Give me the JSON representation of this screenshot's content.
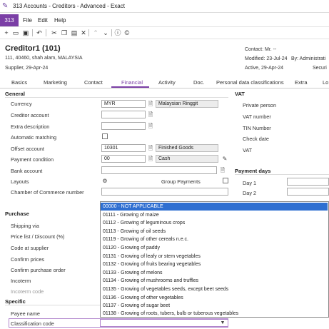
{
  "window": {
    "title": "313 Accounts - Creditors - Advanced - Exact"
  },
  "app": {
    "badge": "313"
  },
  "menu": {
    "file": "File",
    "edit": "Edit",
    "help": "Help"
  },
  "header": {
    "title": "Creditor1 (101)",
    "address": "111, 40460, shah alam, MALAYSIA",
    "supplier": "Supplier, 29-Apr-24",
    "contact": "Contact: Mr. --",
    "modified": "Modified: 23-Jul-24",
    "modified_by": "By: Administrati",
    "active": "Active, 29-Apr-24",
    "securi": "Securi"
  },
  "tabs": [
    "Basics",
    "Marketing",
    "Contact",
    "Financial",
    "Activity",
    "Doc.",
    "Personal data classifications",
    "Extra",
    "Lo"
  ],
  "active_tab": "Financial",
  "general": {
    "section": "General",
    "currency_label": "Currency",
    "currency_value": "MYR",
    "currency_name": "Malaysian Ringgit",
    "creditor_account_label": "Creditor account",
    "extra_description_label": "Extra description",
    "automatic_matching_label": "Automatic matching",
    "offset_account_label": "Offset account",
    "offset_account_value": "10301",
    "offset_account_name": "Finished Goods",
    "payment_condition_label": "Payment condition",
    "payment_condition_value": "00",
    "payment_condition_name": "Cash",
    "bank_account_label": "Bank account",
    "layouts_label": "Layouts",
    "group_payments_label": "Group Payments",
    "coc_label": "Chamber of Commerce number"
  },
  "vat": {
    "section": "VAT",
    "private_person": "Private person",
    "vat_number": "VAT number",
    "tin_number": "TIN Number",
    "check_date": "Check date",
    "vat": "VAT"
  },
  "payment_days": {
    "section": "Payment days",
    "day1": "Day 1",
    "day2": "Day 2"
  },
  "purchase": {
    "section": "Purchase",
    "shipping_via": "Shipping via",
    "price_list": "Price list / Discount (%)",
    "code_at_supplier": "Code at supplier",
    "confirm_prices": "Confirm prices",
    "confirm_purchase_order": "Confirm purchase order",
    "incoterm": "Incoterm",
    "incoterm_code": "Incoterm code"
  },
  "specific": {
    "section": "Specific",
    "payee_name": "Payee name",
    "classification_code": "Classification code"
  },
  "classification_options": [
    "00000 - NOT APPLICABLE",
    "01111 - Growing of maize",
    "01112 - Growing of leguminous crops",
    "01113 - Growing of oil seeds",
    "01119 - Growing of other cereals n.e.c.",
    "01120 - Growing of paddy",
    "01131 - Growing of leafy or stem vegetables",
    "01132 - Growing of fruits bearing vegetables",
    "01133 - Growing of melons",
    "01134 - Growing of mushrooms and truffles",
    "01135 - Growing of vegetables seeds, except beet seeds",
    "01136 - Growing of other vegetables",
    "01137 - Growing of sugar beet",
    "01138 - Growing of roots, tubers, bulb or tuberous vegetables"
  ],
  "selected_index": 0,
  "icons": {
    "app": "edit-icon",
    "new": "plus-icon",
    "open": "folder-icon",
    "save": "save-icon",
    "undo": "undo-icon",
    "cut": "scissors-icon",
    "copy": "copy-icon",
    "paste": "paste-icon",
    "delete": "close-icon",
    "up": "chevron-up-icon",
    "down": "chevron-down-icon",
    "info": "info-icon",
    "copyright": "copyright-icon"
  },
  "colors": {
    "accent": "#7b3fa6",
    "selection": "#2f6fd1"
  }
}
